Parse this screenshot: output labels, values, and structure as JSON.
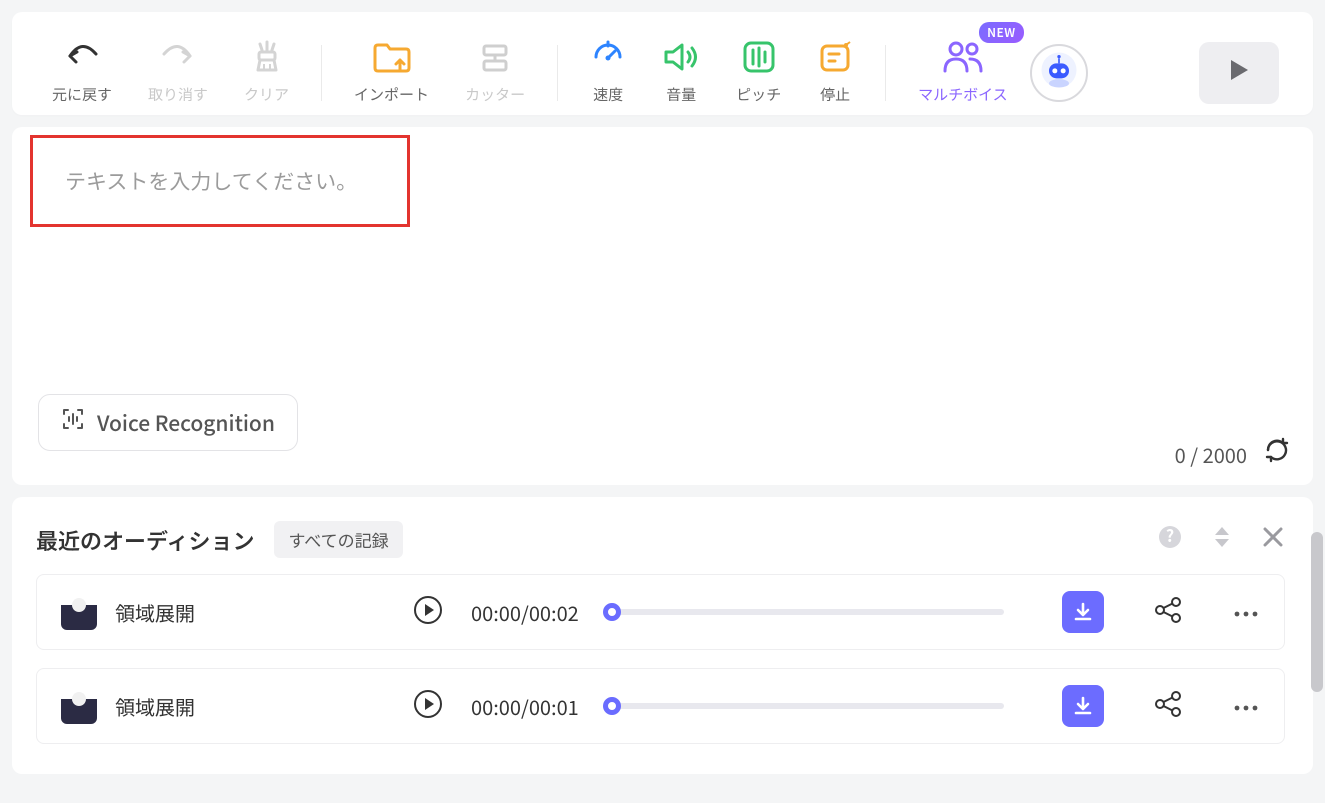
{
  "toolbar": {
    "undo": "元に戻す",
    "redo": "取り消す",
    "clear": "クリア",
    "import": "インポート",
    "cutter": "カッター",
    "speed": "速度",
    "volume": "音量",
    "pitch": "ピッチ",
    "pause": "停止",
    "multivoice": "マルチボイス",
    "new_badge": "NEW"
  },
  "editor": {
    "placeholder": "テキストを入力してください。",
    "voice_recognition_label": "Voice Recognition",
    "count_current": "0",
    "count_sep": " / ",
    "count_max": "2000"
  },
  "auditions": {
    "title": "最近のオーディション",
    "all_records": "すべての記録",
    "rows": [
      {
        "name": "領域展開",
        "elapsed": "00:00",
        "total": "00:02"
      },
      {
        "name": "領域展開",
        "elapsed": "00:00",
        "total": "00:01"
      }
    ]
  }
}
